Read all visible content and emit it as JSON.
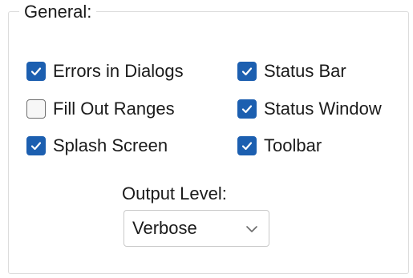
{
  "group": {
    "title": "General:"
  },
  "options": {
    "errors_in_dialogs": {
      "label": "Errors in Dialogs",
      "checked": true
    },
    "fill_out_ranges": {
      "label": "Fill Out Ranges",
      "checked": false
    },
    "splash_screen": {
      "label": "Splash Screen",
      "checked": true
    },
    "status_bar": {
      "label": "Status Bar",
      "checked": true
    },
    "status_window": {
      "label": "Status Window",
      "checked": true
    },
    "toolbar": {
      "label": "Toolbar",
      "checked": true
    }
  },
  "output_level": {
    "label": "Output Level:",
    "selected": "Verbose",
    "icon": "chevron-down-icon"
  },
  "colors": {
    "checkbox_checked": "#1c5fb0",
    "group_border": "#dcdcdc"
  }
}
